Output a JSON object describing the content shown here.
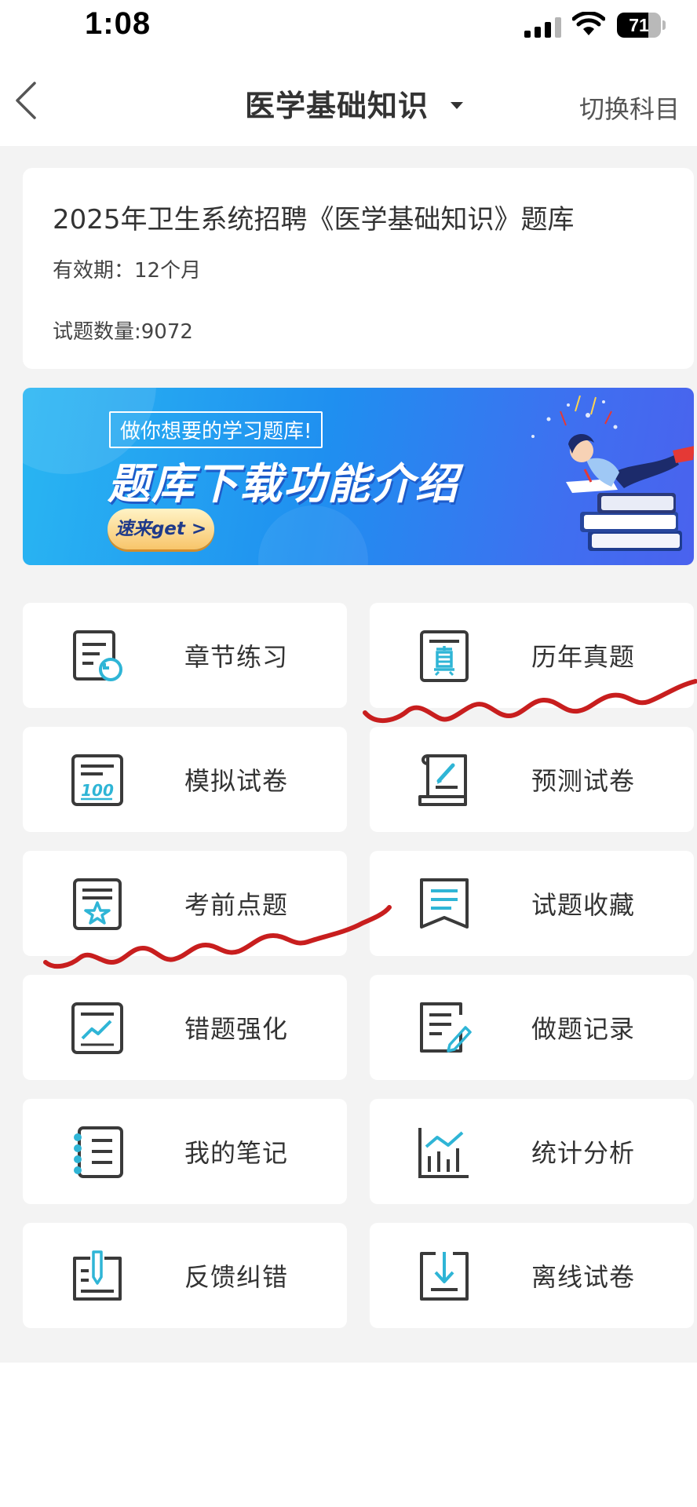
{
  "status_bar": {
    "time": "1:08",
    "battery_percent": "71",
    "battery_level": 0.71,
    "icons": [
      "signal-icon",
      "wifi-icon",
      "battery-icon"
    ]
  },
  "nav": {
    "back_icon": "chevron-left-icon",
    "title": "医学基础知识",
    "title_dropdown_icon": "caret-down-icon",
    "switch_label": "切换科目"
  },
  "info_card": {
    "title": "2025年卫生系统招聘《医学基础知识》题库",
    "validity": "有效期：12个月",
    "question_count": "试题数量:9072"
  },
  "banner": {
    "tag": "做你想要的学习题库!",
    "headline": "题库下载功能介绍",
    "cta": "速来get >"
  },
  "colors": {
    "accent": "#2fb5d6",
    "icon_stroke": "#3a3a3a",
    "page_bg": "#f3f3f3",
    "annotation_red": "#c81e1e"
  },
  "menu": [
    {
      "label": "章节练习",
      "icon": "chapter-practice-icon"
    },
    {
      "label": "历年真题",
      "icon": "past-exam-icon"
    },
    {
      "label": "模拟试卷",
      "icon": "mock-exam-icon"
    },
    {
      "label": "预测试卷",
      "icon": "forecast-exam-icon"
    },
    {
      "label": "考前点题",
      "icon": "pre-exam-tips-icon"
    },
    {
      "label": "试题收藏",
      "icon": "favorites-icon"
    },
    {
      "label": "错题强化",
      "icon": "mistakes-icon"
    },
    {
      "label": "做题记录",
      "icon": "practice-record-icon"
    },
    {
      "label": "我的笔记",
      "icon": "notes-icon"
    },
    {
      "label": "统计分析",
      "icon": "statistics-icon"
    },
    {
      "label": "反馈纠错",
      "icon": "feedback-icon"
    },
    {
      "label": "离线试卷",
      "icon": "offline-download-icon"
    }
  ]
}
